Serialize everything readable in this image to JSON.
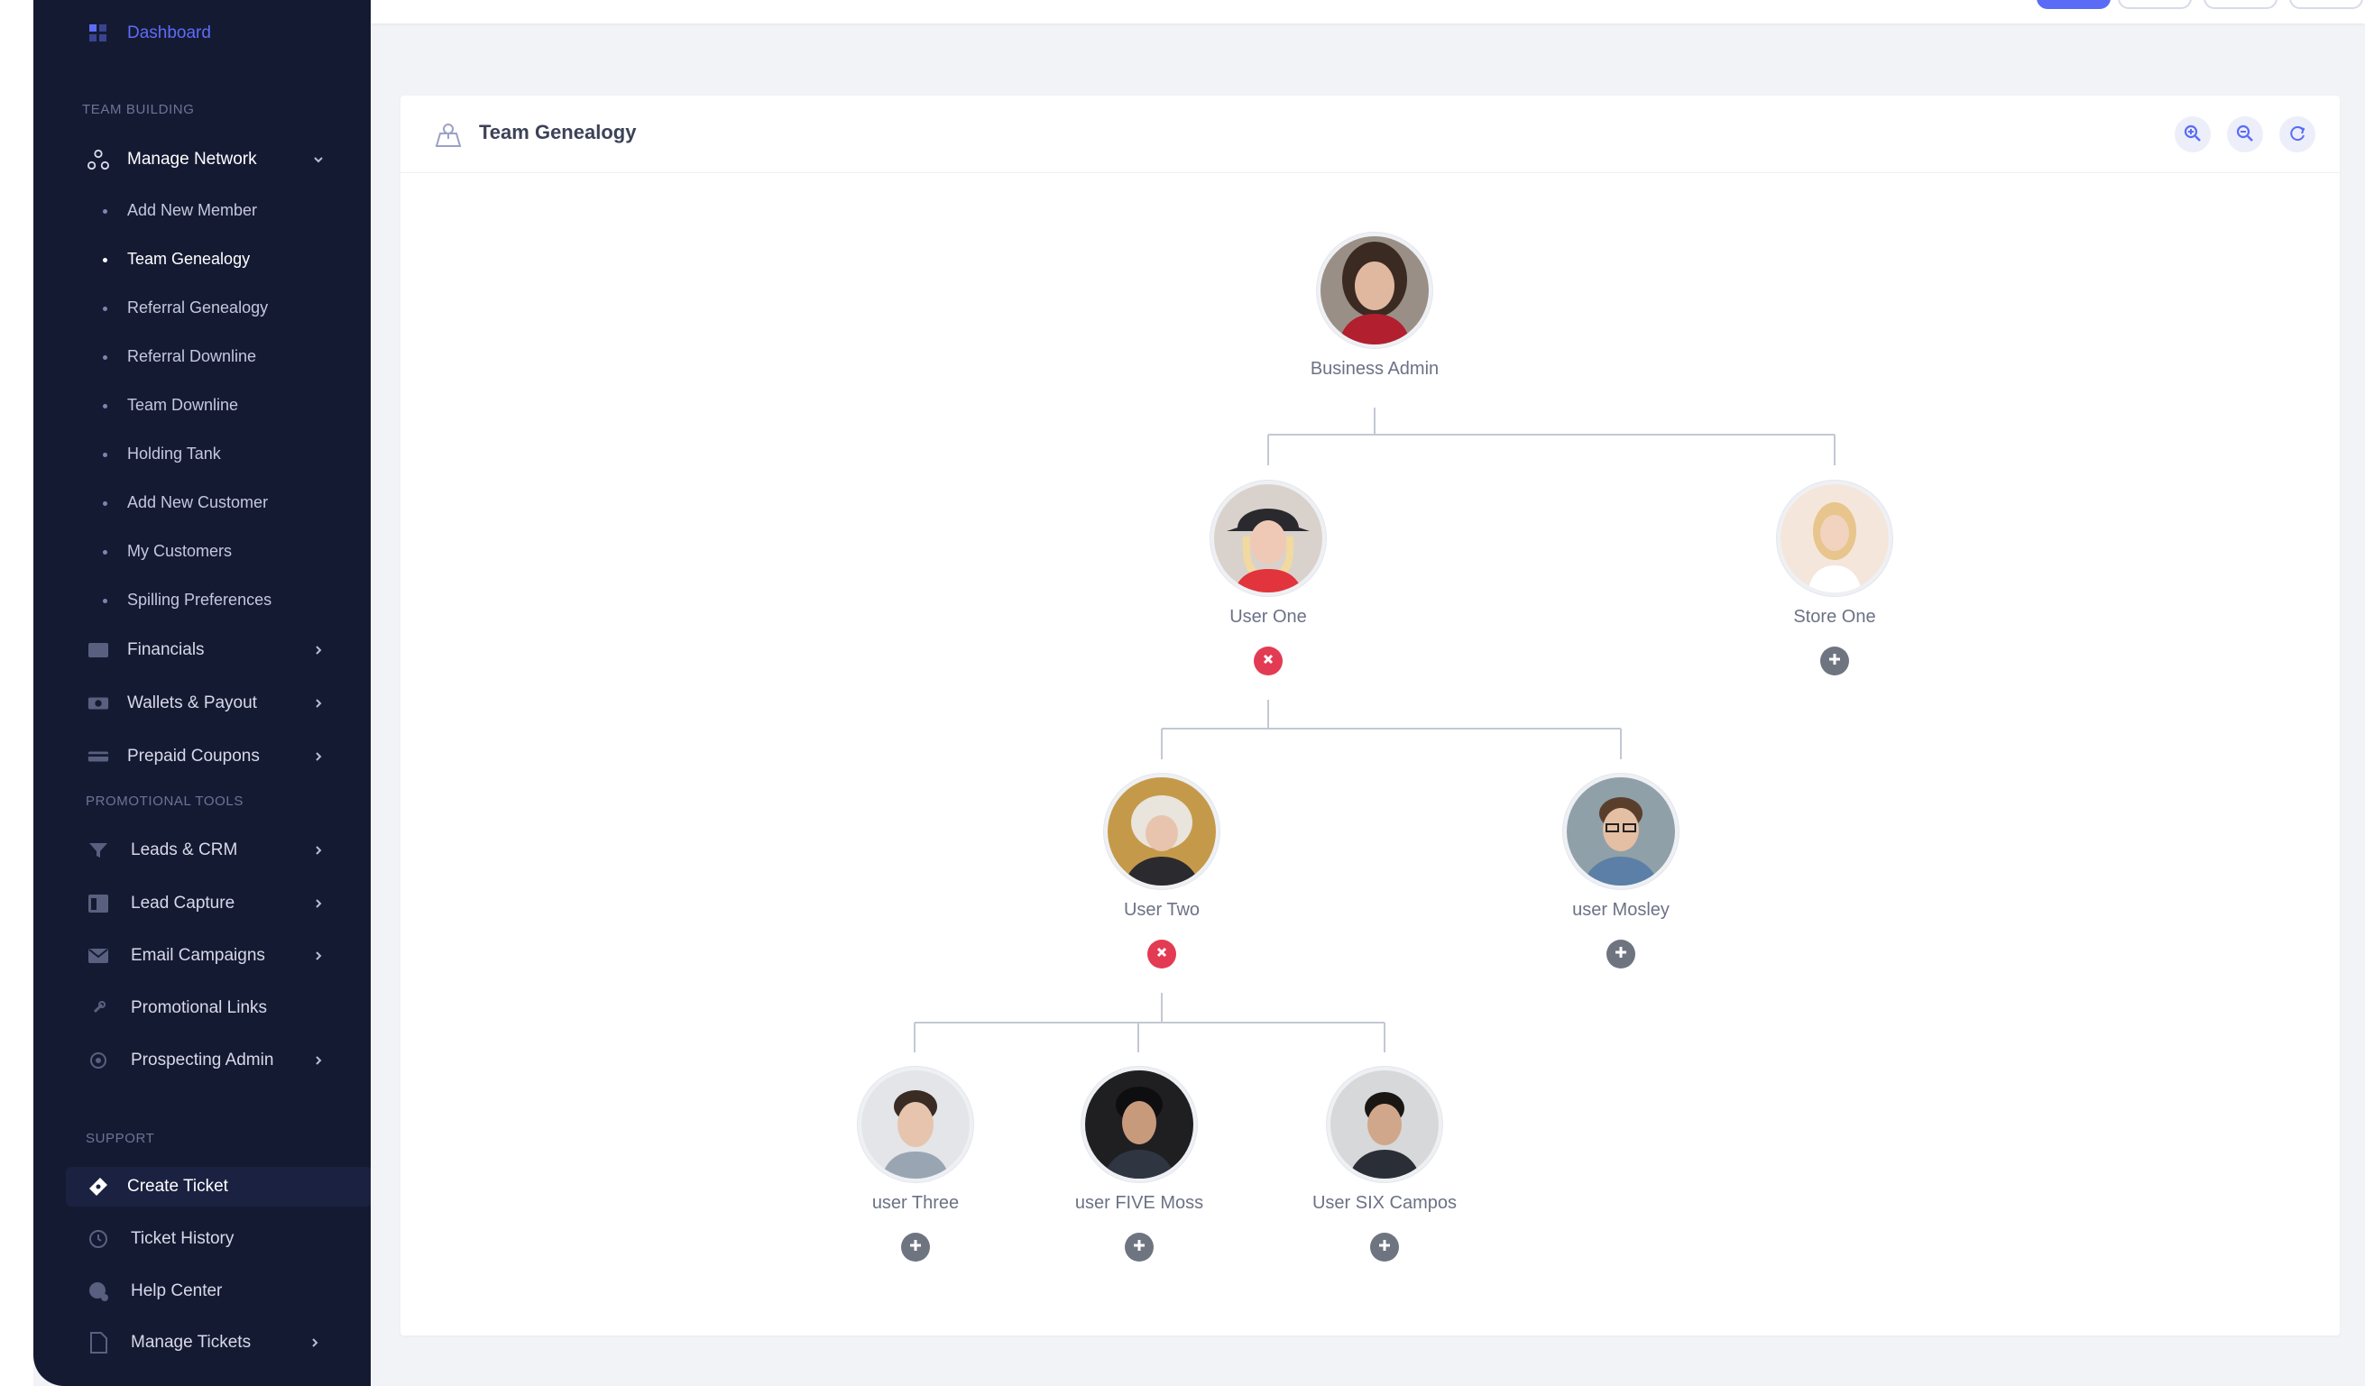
{
  "sidebar": {
    "dashboard": "Dashboard",
    "section_team": "TEAM BUILDING",
    "manage_network": "Manage Network",
    "network_items": [
      {
        "label": "Add New Member",
        "active": false
      },
      {
        "label": "Team Genealogy",
        "active": true
      },
      {
        "label": "Referral Genealogy",
        "active": false
      },
      {
        "label": "Referral Downline",
        "active": false
      },
      {
        "label": "Team Downline",
        "active": false
      },
      {
        "label": "Holding Tank",
        "active": false
      },
      {
        "label": "Add New Customer",
        "active": false
      },
      {
        "label": "My Customers",
        "active": false
      },
      {
        "label": "Spilling Preferences",
        "active": false
      }
    ],
    "financials": "Financials",
    "wallets": "Wallets & Payout",
    "coupons": "Prepaid Coupons",
    "section_promo": "PROMOTIONAL TOOLS",
    "leads_crm": "Leads & CRM",
    "lead_capture": "Lead Capture",
    "email_campaigns": "Email Campaigns",
    "promo_links": "Promotional Links",
    "prospecting_admin": "Prospecting Admin",
    "section_support": "SUPPORT",
    "create_ticket": "Create Ticket",
    "ticket_history": "Ticket History",
    "help_center": "Help Center",
    "manage_tickets": "Manage Tickets"
  },
  "card": {
    "title": "Team Genealogy",
    "tools": [
      "zoom-in-icon",
      "zoom-out-icon",
      "refresh-icon"
    ]
  },
  "tree": {
    "root": {
      "name": "Business Admin"
    },
    "user_one": {
      "name": "User One",
      "action": "remove"
    },
    "store_one": {
      "name": "Store One",
      "action": "add"
    },
    "user_two": {
      "name": "User Two",
      "action": "remove"
    },
    "user_mosley": {
      "name": "user Mosley",
      "action": "add"
    },
    "user_three": {
      "name": "user Three",
      "action": "add"
    },
    "user_five": {
      "name": "user FIVE Moss",
      "action": "add"
    },
    "user_six": {
      "name": "User SIX Campos",
      "action": "add"
    }
  },
  "colors": {
    "sidebar_bg": "#151a33",
    "accent": "#5a6cf5",
    "remove": "#e33b53",
    "add": "#6f7481"
  }
}
